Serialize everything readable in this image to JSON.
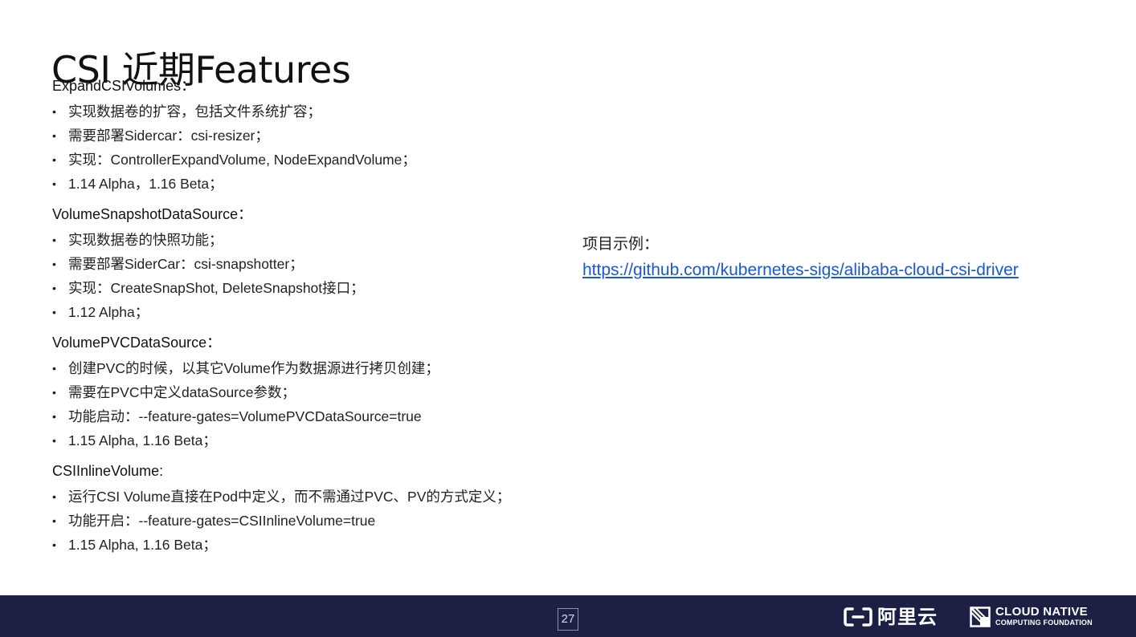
{
  "title": "CSI 近期Features",
  "bullet_symbol": "•",
  "sections": [
    {
      "heading": "ExpandCSIVolumes：",
      "items": [
        "实现数据卷的扩容，包括文件系统扩容；",
        "需要部署Sidercar：csi-resizer；",
        "实现：ControllerExpandVolume, NodeExpandVolume；",
        "1.14 Alpha，1.16 Beta；"
      ]
    },
    {
      "heading": "VolumeSnapshotDataSource：",
      "items": [
        "实现数据卷的快照功能；",
        "需要部署SiderCar：csi-snapshotter；",
        "实现：CreateSnapShot, DeleteSnapshot接口；",
        "1.12 Alpha；"
      ]
    },
    {
      "heading": "VolumePVCDataSource：",
      "items": [
        "创建PVC的时候，以其它Volume作为数据源进行拷贝创建；",
        "需要在PVC中定义dataSource参数；",
        "功能启动：--feature-gates=VolumePVCDataSource=true",
        "1.15 Alpha, 1.16 Beta；"
      ]
    },
    {
      "heading": "CSIInlineVolume:",
      "items": [
        "运行CSI Volume直接在Pod中定义，而不需通过PVC、PV的方式定义；",
        "功能开启：--feature-gates=CSIInlineVolume=true",
        "1.15 Alpha, 1.16 Beta；"
      ]
    }
  ],
  "example": {
    "label": "项目示例：",
    "link": "https://github.com/kubernetes-sigs/alibaba-cloud-csi-driver"
  },
  "footer": {
    "page_number": "27",
    "aliyun_logo_text": "阿里云",
    "cncf_line1": "CLOUD NATIVE",
    "cncf_line2": "COMPUTING FOUNDATION",
    "background_color": "#1c2045"
  }
}
